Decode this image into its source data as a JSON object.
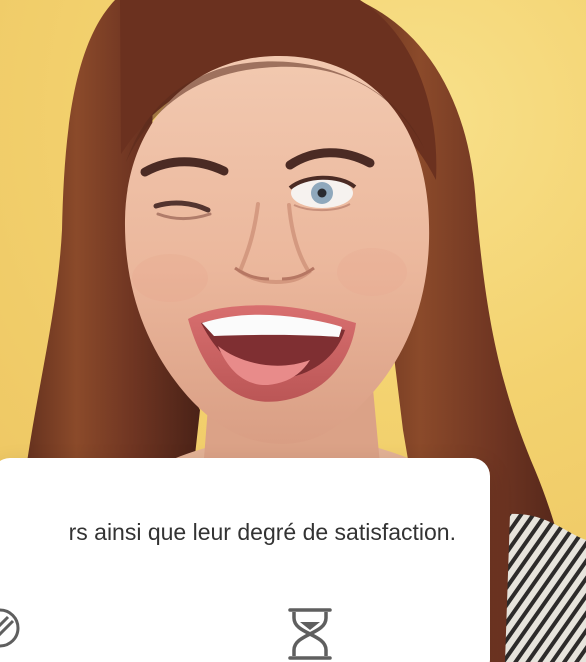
{
  "card": {
    "text": "rs ainsi que leur degré de satisfaction."
  },
  "icons": {
    "left": "circular-badge-icon",
    "right": "hourglass-icon"
  }
}
